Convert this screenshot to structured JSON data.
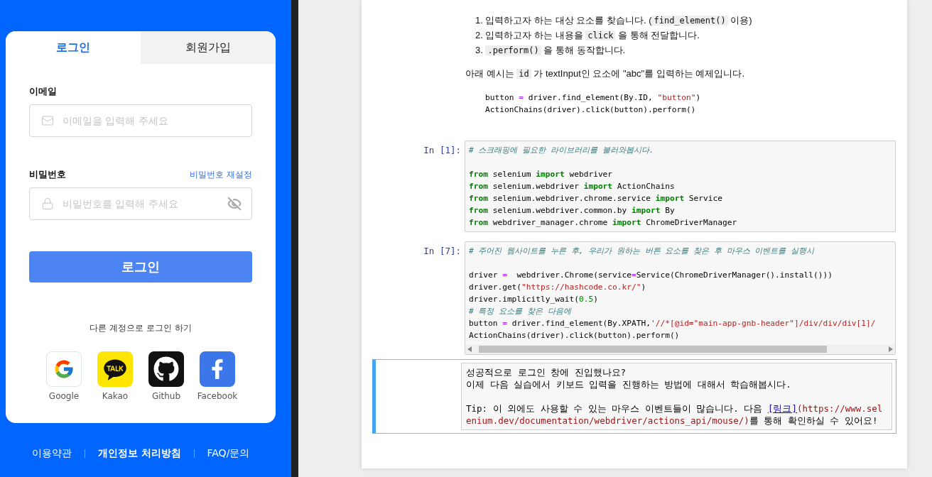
{
  "login": {
    "tabs": [
      {
        "label": "로그인",
        "selected": true
      },
      {
        "label": "회원가입",
        "selected": false
      }
    ],
    "email": {
      "label": "이메일",
      "placeholder": "이메일을 입력해 주세요"
    },
    "password": {
      "label": "비밀번호",
      "reset_link": "비밀번호 재설정",
      "placeholder": "비밀번호를 입력해 주세요"
    },
    "submit": "로그인",
    "other_title": "다른 계정으로 로그인 하기",
    "social": [
      {
        "kind": "google",
        "label": "Google"
      },
      {
        "kind": "kakao",
        "label": "Kakao"
      },
      {
        "kind": "github",
        "label": "Github"
      },
      {
        "kind": "facebook",
        "label": "Facebook"
      }
    ],
    "footer": [
      {
        "label": "이용약관",
        "bold": false
      },
      {
        "label": "개인정보 처리방침",
        "bold": true
      },
      {
        "label": "FAQ/문의",
        "bold": false
      }
    ]
  },
  "notebook": {
    "intro_list": [
      {
        "number": "1.",
        "segments": [
          {
            "kind": "text",
            "text": "입력하고자 하는 대상 요소를 찾습니다. ("
          },
          {
            "kind": "code",
            "text": "find_element()"
          },
          {
            "kind": "text",
            "text": " 이용)"
          }
        ]
      },
      {
        "number": "2.",
        "segments": [
          {
            "kind": "text",
            "text": "입력하고자 하는 내용을 "
          },
          {
            "kind": "code",
            "text": "click"
          },
          {
            "kind": "text",
            "text": " 을 통해 전달합니다."
          }
        ]
      },
      {
        "number": "3.",
        "segments": [
          {
            "kind": "code",
            "text": ".perform()"
          },
          {
            "kind": "text",
            "text": " 을 통해 동작합니다."
          }
        ]
      }
    ],
    "intro_paragraph": [
      {
        "kind": "text",
        "text": "아래 예시는 "
      },
      {
        "kind": "code",
        "text": "id"
      },
      {
        "kind": "text",
        "text": " 가 textInput인 요소에 \"abc\"를 입력하는 예제입니다."
      }
    ],
    "example_code": [
      [
        {
          "kind": "plain",
          "text": "button "
        },
        {
          "kind": "op",
          "text": "="
        },
        {
          "kind": "plain",
          "text": " driver.find_element(By.ID, "
        },
        {
          "kind": "str",
          "text": "\"button\""
        },
        {
          "kind": "plain",
          "text": ")"
        }
      ],
      [
        {
          "kind": "plain",
          "text": "ActionChains(driver).click(button).perform()"
        }
      ]
    ],
    "cells": [
      {
        "prompt": "In [1]:",
        "scrollbar": false,
        "blocks": [
          [
            [
              {
                "kind": "comment",
                "text": "# 스크래핑에 필요한 라이브러리를 불러와봅시다."
              }
            ]
          ],
          [
            [
              {
                "kind": "kw",
                "text": "from"
              },
              {
                "kind": "plain",
                "text": " selenium "
              },
              {
                "kind": "kw",
                "text": "import"
              },
              {
                "kind": "plain",
                "text": " webdriver"
              }
            ],
            [
              {
                "kind": "kw",
                "text": "from"
              },
              {
                "kind": "plain",
                "text": " selenium.webdriver "
              },
              {
                "kind": "kw",
                "text": "import"
              },
              {
                "kind": "plain",
                "text": " ActionChains"
              }
            ],
            [
              {
                "kind": "kw",
                "text": "from"
              },
              {
                "kind": "plain",
                "text": " selenium.webdriver.chrome.service "
              },
              {
                "kind": "kw",
                "text": "import"
              },
              {
                "kind": "plain",
                "text": " Service"
              }
            ],
            [
              {
                "kind": "kw",
                "text": "from"
              },
              {
                "kind": "plain",
                "text": " selenium.webdriver.common.by "
              },
              {
                "kind": "kw",
                "text": "import"
              },
              {
                "kind": "plain",
                "text": " By"
              }
            ],
            [
              {
                "kind": "kw",
                "text": "from"
              },
              {
                "kind": "plain",
                "text": " webdriver_manager.chrome "
              },
              {
                "kind": "kw",
                "text": "import"
              },
              {
                "kind": "plain",
                "text": " ChromeDriverManager"
              }
            ]
          ]
        ]
      },
      {
        "prompt": "In [7]:",
        "scrollbar": true,
        "blocks": [
          [
            [
              {
                "kind": "comment",
                "text": "# 주어진 웹사이트를 누른 후, 우리가 원하는 버튼 요소를 찾은 후 마우스 이벤트를 실행시"
              }
            ]
          ],
          [
            [
              {
                "kind": "plain",
                "text": "driver "
              },
              {
                "kind": "op",
                "text": "="
              },
              {
                "kind": "plain",
                "text": "  webdriver.Chrome(service"
              },
              {
                "kind": "op",
                "text": "="
              },
              {
                "kind": "plain",
                "text": "Service(ChromeDriverManager().install()))"
              }
            ],
            [
              {
                "kind": "plain",
                "text": "driver.get("
              },
              {
                "kind": "str",
                "text": "\"https://hashcode.co.kr/\""
              },
              {
                "kind": "plain",
                "text": ")"
              }
            ],
            [
              {
                "kind": "plain",
                "text": "driver.implicitly_wait("
              },
              {
                "kind": "num",
                "text": "0.5"
              },
              {
                "kind": "plain",
                "text": ")"
              }
            ],
            [
              {
                "kind": "comment",
                "text": "# 특정 요소를 찾은 다음에"
              }
            ],
            [
              {
                "kind": "plain",
                "text": "button "
              },
              {
                "kind": "op",
                "text": "="
              },
              {
                "kind": "plain",
                "text": " driver.find_element(By.XPATH,"
              },
              {
                "kind": "str",
                "text": "'//*[@id=\"main-app-gnb-header\"]/div/div/div[1]/"
              }
            ],
            [
              {
                "kind": "plain",
                "text": "ActionChains(driver).click(button).perform()"
              }
            ]
          ]
        ]
      }
    ],
    "markdown_cell": {
      "selected": true,
      "paragraphs": [
        [
          {
            "kind": "text",
            "text": "성공적으로 로그인 창에 진입했나요?"
          }
        ],
        [
          {
            "kind": "text",
            "text": "이제 다음 실습에서 키보드 입력을 진행하는 방법에 대해서 학습해봅시다."
          }
        ],
        [
          {
            "kind": "text",
            "text": "Tip: 이 외에도 사용할 수 있는 마우스 이벤트들이 많습니다. 다음 "
          },
          {
            "kind": "link",
            "text": "[링크]"
          },
          {
            "kind": "url",
            "text": "(https://www.selenium.dev/documentation/webdriver/actions_api/mouse/)"
          },
          {
            "kind": "text",
            "text": "를 통해 확인하실 수 있어요!"
          }
        ]
      ]
    }
  }
}
